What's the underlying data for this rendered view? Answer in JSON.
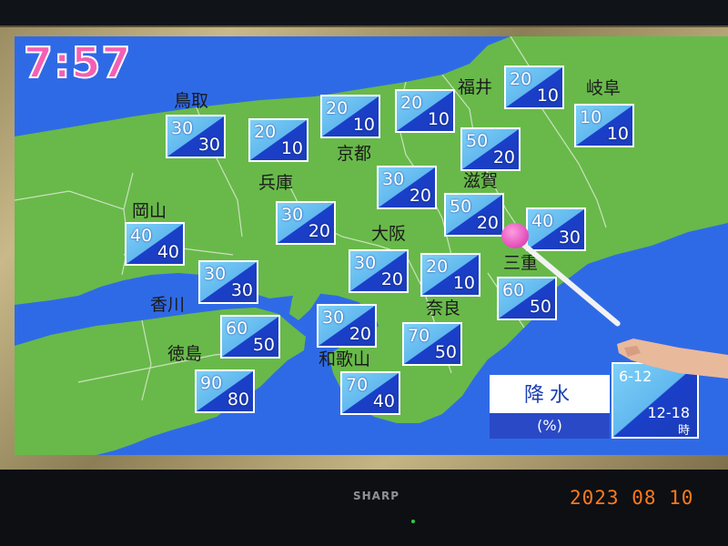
{
  "broadcast": {
    "time": "7:57",
    "legend": {
      "title": "降水",
      "unit": "(%)",
      "period_am": "6-12",
      "period_pm": "12-18",
      "period_suffix": "時"
    }
  },
  "prefectures": [
    {
      "name": "鳥取",
      "am": "30",
      "pm": "30"
    },
    {
      "name": "兵庫",
      "am": "30",
      "pm": "20"
    },
    {
      "name": "京都",
      "am": "20",
      "pm": "10"
    },
    {
      "name": "福井",
      "am": "20",
      "pm": "10"
    },
    {
      "name": "岐阜",
      "am": "10",
      "pm": "10"
    },
    {
      "name": "滋賀",
      "am": "50",
      "pm": "20"
    },
    {
      "name": "岡山",
      "am": "40",
      "pm": "40"
    },
    {
      "name": "大阪",
      "am": "30",
      "pm": "20"
    },
    {
      "name": "三重",
      "am": "40",
      "pm": "30"
    },
    {
      "name": "香川",
      "am": "30",
      "pm": "30"
    },
    {
      "name": "奈良",
      "am": "20",
      "pm": "10"
    },
    {
      "name": "徳島",
      "am": "60",
      "pm": "50"
    },
    {
      "name": "和歌山",
      "am": "30",
      "pm": "20"
    }
  ],
  "extra_boxes": [
    {
      "am": "20",
      "pm": "10"
    },
    {
      "am": "20",
      "pm": "10"
    },
    {
      "am": "50",
      "pm": "20"
    },
    {
      "am": "30",
      "pm": "20"
    },
    {
      "am": "60",
      "pm": "50"
    },
    {
      "am": "70",
      "pm": "50"
    },
    {
      "am": "90",
      "pm": "80"
    },
    {
      "am": "70",
      "pm": "40"
    }
  ],
  "tv": {
    "brand": "SHARP"
  },
  "photo": {
    "date_stamp": "2023 08 10"
  },
  "colors": {
    "sea": "#2f6ae6",
    "land": "#68b94a",
    "clock": "#f45fb4",
    "box_light": "#7fd0f7",
    "box_dark": "#1a3fc9",
    "date_stamp": "#ff7a1c"
  }
}
